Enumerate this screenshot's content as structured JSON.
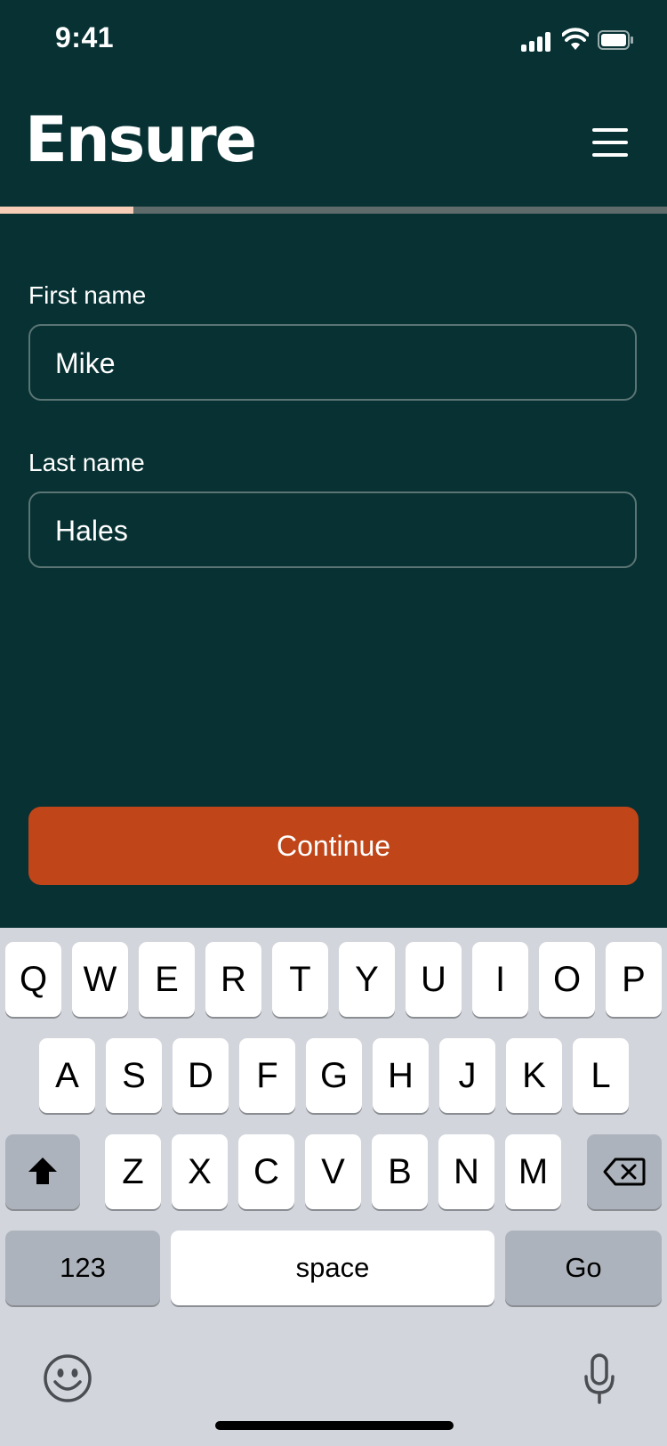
{
  "status_bar": {
    "time": "9:41"
  },
  "header": {
    "logo": "Ensure"
  },
  "progress": {
    "fraction": 0.2
  },
  "form": {
    "first_name": {
      "label": "First name",
      "value": "Mike"
    },
    "last_name": {
      "label": "Last name",
      "value": "Hales"
    },
    "continue_label": "Continue"
  },
  "keyboard": {
    "row1": [
      "Q",
      "W",
      "E",
      "R",
      "T",
      "Y",
      "U",
      "I",
      "O",
      "P"
    ],
    "row2": [
      "A",
      "S",
      "D",
      "F",
      "G",
      "H",
      "J",
      "K",
      "L"
    ],
    "row3": [
      "Z",
      "X",
      "C",
      "V",
      "B",
      "N",
      "M"
    ],
    "numbers_label": "123",
    "space_label": "space",
    "go_label": "Go",
    "icons": [
      "shift-icon",
      "delete-icon",
      "emoji-icon",
      "microphone-icon"
    ]
  },
  "colors": {
    "background": "#073133",
    "accent": "#c04518",
    "progress": "#f6cdb7",
    "keyboard": "#d2d5db"
  }
}
